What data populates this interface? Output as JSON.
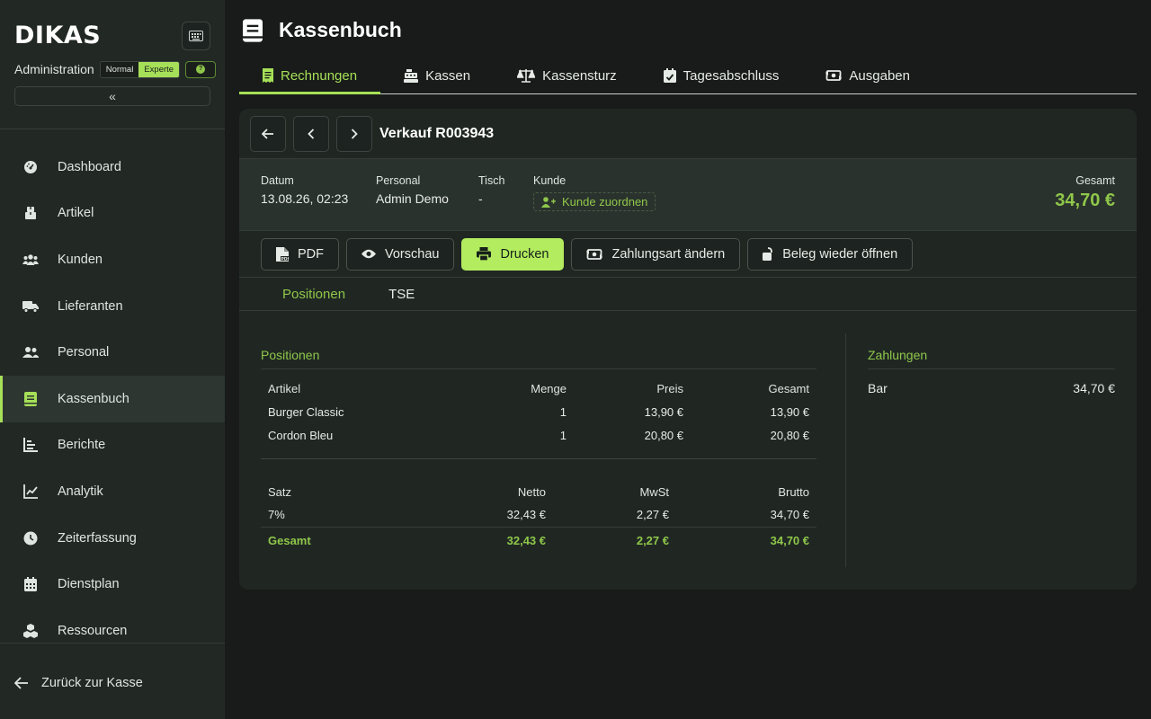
{
  "app": {
    "logo": "DIKAS"
  },
  "sidebar": {
    "admin_label": "Administration",
    "mode_normal": "Normal",
    "mode_expert": "Experte",
    "items": [
      {
        "label": "Dashboard",
        "icon": "dashboard-icon"
      },
      {
        "label": "Artikel",
        "icon": "boxes-icon"
      },
      {
        "label": "Kunden",
        "icon": "users-icon"
      },
      {
        "label": "Lieferanten",
        "icon": "truck-icon"
      },
      {
        "label": "Personal",
        "icon": "user-group-icon"
      },
      {
        "label": "Kassenbuch",
        "icon": "book-icon",
        "active": true
      },
      {
        "label": "Berichte",
        "icon": "bar-chart-icon"
      },
      {
        "label": "Analytik",
        "icon": "line-chart-icon"
      },
      {
        "label": "Zeiterfassung",
        "icon": "clock-icon"
      },
      {
        "label": "Dienstplan",
        "icon": "calendar-icon"
      },
      {
        "label": "Ressourcen",
        "icon": "cubes-icon"
      }
    ],
    "back_label": "Zurück zur Kasse"
  },
  "page": {
    "title": "Kassenbuch",
    "tabs": [
      {
        "label": "Rechnungen",
        "active": true
      },
      {
        "label": "Kassen"
      },
      {
        "label": "Kassensturz"
      },
      {
        "label": "Tagesabschluss"
      },
      {
        "label": "Ausgaben"
      }
    ]
  },
  "receipt": {
    "title": "Verkauf R003943",
    "date_label": "Datum",
    "date_value": "13.08.26, 02:23",
    "staff_label": "Personal",
    "staff_value": "Admin Demo",
    "table_label": "Tisch",
    "table_value": "-",
    "customer_label": "Kunde",
    "assign_customer": "Kunde zuordnen",
    "total_label": "Gesamt",
    "total_value": "34,70 €"
  },
  "actions": {
    "pdf": "PDF",
    "preview": "Vorschau",
    "print": "Drucken",
    "change_payment": "Zahlungsart ändern",
    "reopen": "Beleg wieder öffnen"
  },
  "subtabs": {
    "positions": "Positionen",
    "tse": "TSE"
  },
  "positions": {
    "title": "Positionen",
    "headers": {
      "item": "Artikel",
      "qty": "Menge",
      "price": "Preis",
      "total": "Gesamt"
    },
    "rows": [
      {
        "item": "Burger Classic",
        "qty": "1",
        "price": "13,90 €",
        "total": "13,90 €"
      },
      {
        "item": "Cordon Bleu",
        "qty": "1",
        "price": "20,80 €",
        "total": "20,80 €"
      }
    ]
  },
  "taxes": {
    "headers": {
      "rate": "Satz",
      "net": "Netto",
      "vat": "MwSt",
      "gross": "Brutto"
    },
    "rows": [
      {
        "rate": "7%",
        "net": "32,43 €",
        "vat": "2,27 €",
        "gross": "34,70 €"
      }
    ],
    "total": {
      "label": "Gesamt",
      "net": "32,43 €",
      "vat": "2,27 €",
      "gross": "34,70 €"
    }
  },
  "payments": {
    "title": "Zahlungen",
    "rows": [
      {
        "method": "Bar",
        "amount": "34,70 €"
      }
    ]
  },
  "colors": {
    "accent": "#a6e058",
    "accent_text": "#8fc74a",
    "bg": "#181b19",
    "sidebar": "#222925"
  }
}
